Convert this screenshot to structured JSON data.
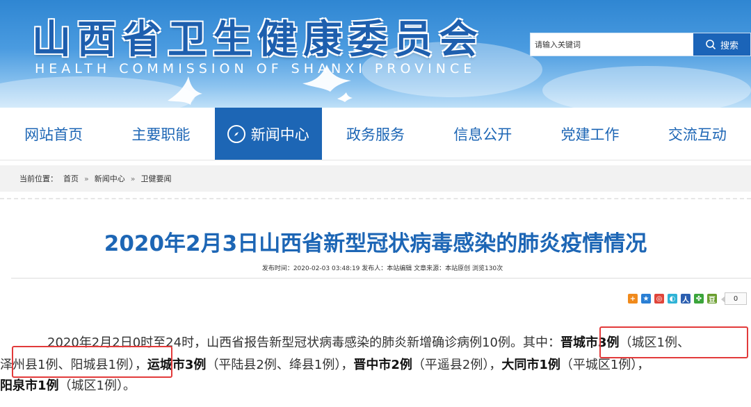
{
  "header": {
    "site_title": "山西省卫生健康委员会",
    "site_subtitle": "HEALTH COMMISSION OF SHANXI PROVINCE",
    "search": {
      "placeholder": "请输入关键词",
      "button_label": "搜索",
      "icon": "search-icon"
    }
  },
  "nav": {
    "items": [
      {
        "label": "网站首页"
      },
      {
        "label": "主要职能"
      },
      {
        "label": "新闻中心",
        "icon": "compass-icon",
        "active": true
      },
      {
        "label": "政务服务"
      },
      {
        "label": "信息公开"
      },
      {
        "label": "党建工作"
      },
      {
        "label": "交流互动"
      }
    ]
  },
  "breadcrumb": {
    "prefix": "当前位置：",
    "items": [
      "首页",
      "新闻中心",
      "卫健要闻"
    ],
    "separator": "»"
  },
  "article": {
    "title": "2020年2月3日山西省新型冠状病毒感染的肺炎疫情情况",
    "meta": "发布时间：2020-02-03 03:48:19  发布人：本站编辑  文章来源：本站原创  浏览130次",
    "share_count": "0",
    "paragraph": {
      "l1_normal": "2020年2月2日0时至24时，山西省报告新型冠状病毒感染的肺炎新增确诊病例10例。其中：",
      "l1_bold": "晋城市3例",
      "l1_tail": "（城区1例、",
      "l2_a": "泽州县1例、阳城县1例）",
      "l2_b": "，",
      "l2_c": "运城市3例",
      "l2_d": "（平陆县2例、绛县1例），",
      "l2_e": "晋中市2例",
      "l2_f": "（平遥县2例），",
      "l2_g": "大同市1例",
      "l2_h": "（平城区1例），",
      "l3_a": "阳泉市1例",
      "l3_b": "（城区1例）。"
    }
  },
  "colors": {
    "brand_blue": "#1d66b5",
    "highlight_red": "#e23a3a"
  }
}
